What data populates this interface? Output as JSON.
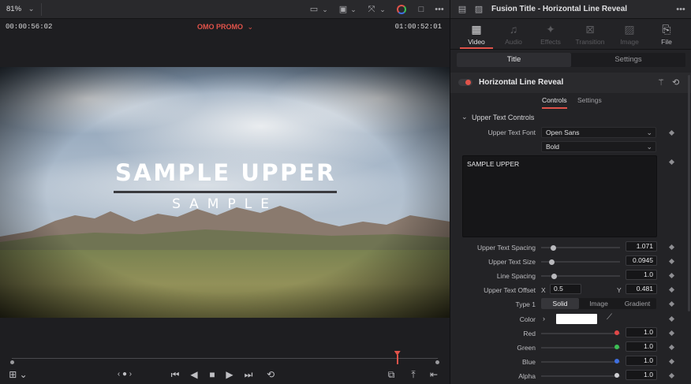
{
  "viewer": {
    "zoom": "81%",
    "timecode_left": "00:00:56:02",
    "clip_name": "OMO PROMO",
    "timecode_right": "01:00:52:01",
    "overlay_upper": "SAMPLE UPPER",
    "overlay_lower": "SAMPLE",
    "playhead_fraction": 0.905
  },
  "inspector": {
    "title": "Fusion Title - Horizontal Line Reveal",
    "tabs": [
      {
        "label": "Video",
        "icon": "film-icon"
      },
      {
        "label": "Audio",
        "icon": "music-note-icon"
      },
      {
        "label": "Effects",
        "icon": "sparkle-icon"
      },
      {
        "label": "Transition",
        "icon": "transition-icon"
      },
      {
        "label": "Image",
        "icon": "image-icon"
      },
      {
        "label": "File",
        "icon": "file-icon"
      }
    ],
    "subtabs": [
      "Title",
      "Settings"
    ],
    "effect_name": "Horizontal Line Reveal",
    "control_tabs": [
      "Controls",
      "Settings"
    ],
    "section_title": "Upper Text Controls",
    "font_label": "Upper Text Font",
    "font_value": "Open Sans",
    "font_style": "Bold",
    "text_value": "SAMPLE UPPER",
    "params": {
      "spacing": {
        "label": "Upper Text Spacing",
        "value": "1.071",
        "fraction": 0.12
      },
      "size": {
        "label": "Upper Text Size",
        "value": "0.0945",
        "fraction": 0.1
      },
      "line_spacing": {
        "label": "Line Spacing",
        "value": "1.0",
        "fraction": 0.13
      }
    },
    "offset": {
      "label": "Upper Text Offset",
      "x_label": "X",
      "x": "0.5",
      "y_label": "Y",
      "y": "0.481"
    },
    "type": {
      "label": "Type 1",
      "options": [
        "Solid",
        "Image",
        "Gradient"
      ]
    },
    "color": {
      "label": "Color",
      "swatch": "#ffffff"
    },
    "channels": {
      "red": {
        "label": "Red",
        "value": "1.0",
        "dot": "#e04848"
      },
      "green": {
        "label": "Green",
        "value": "1.0",
        "dot": "#3cbf55"
      },
      "blue": {
        "label": "Blue",
        "value": "1.0",
        "dot": "#3f6fe0"
      },
      "alpha": {
        "label": "Alpha",
        "value": "1.0",
        "dot": "#cfcfd3"
      }
    }
  }
}
